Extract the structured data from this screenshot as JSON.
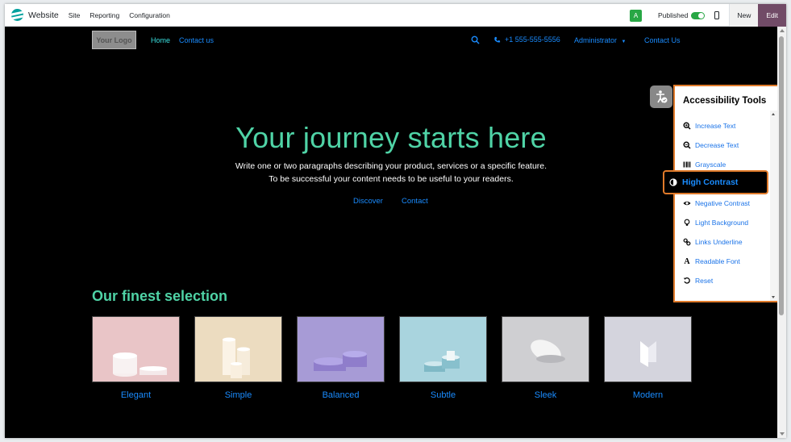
{
  "topbar": {
    "app_title": "Website",
    "menus": [
      "Site",
      "Reporting",
      "Configuration"
    ],
    "avatar_letter": "A",
    "published_label": "Published",
    "published_on": true,
    "new_label": "New",
    "edit_label": "Edit"
  },
  "site_nav": {
    "logo_text": "Your Logo",
    "links": [
      "Home",
      "Contact us"
    ],
    "phone": "+1 555-555-5556",
    "user_menu": "Administrator",
    "cta": "Contact Us"
  },
  "hero": {
    "title": "Your journey starts here",
    "line1": "Write one or two paragraphs describing your product, services or a specific feature.",
    "line2": "To be successful your content needs to be useful to your readers.",
    "button1": "Discover",
    "button2": "Contact"
  },
  "selection": {
    "title": "Our finest selection",
    "items": [
      {
        "label": "Elegant",
        "bg": "#e9c5c7"
      },
      {
        "label": "Simple",
        "bg": "#ecdcc0"
      },
      {
        "label": "Balanced",
        "bg": "#a79bd6"
      },
      {
        "label": "Subtle",
        "bg": "#a9d4de"
      },
      {
        "label": "Sleek",
        "bg": "#cfcfd2"
      },
      {
        "label": "Modern",
        "bg": "#d4d4dd"
      }
    ]
  },
  "accessibility": {
    "title": "Accessibility Tools",
    "items": [
      {
        "label": "Increase Text",
        "icon": "zoom-in-icon"
      },
      {
        "label": "Decrease Text",
        "icon": "zoom-out-icon"
      },
      {
        "label": "Grayscale",
        "icon": "barcode-icon"
      },
      {
        "label": "High Contrast",
        "icon": "contrast-icon",
        "active": true
      },
      {
        "label": "Negative Contrast",
        "icon": "eye-icon"
      },
      {
        "label": "Light Background",
        "icon": "lightbulb-icon"
      },
      {
        "label": "Links Underline",
        "icon": "link-icon"
      },
      {
        "label": "Readable Font",
        "icon": "font-icon"
      },
      {
        "label": "Reset",
        "icon": "reset-icon"
      }
    ]
  },
  "colors": {
    "accent_green": "#4fd3a6",
    "link_blue": "#1a8cff",
    "edit_purple": "#714b67",
    "highlight_orange": "#e07a2a"
  }
}
